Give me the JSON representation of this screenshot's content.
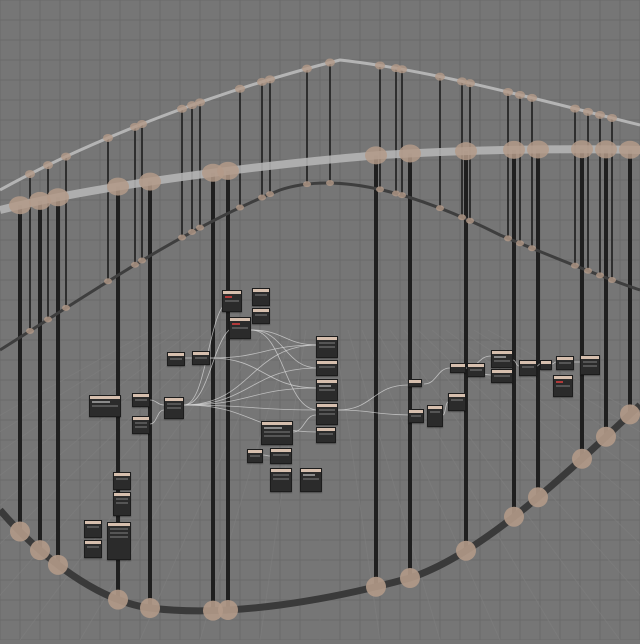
{
  "scene": {
    "background": "#767676",
    "grid_color": "#6a6a6a",
    "rail_color": "#3e3e3e",
    "guide_color": "#b4b4b4",
    "joint_color": "#b39a88",
    "node_body_color": "#2b2b2b",
    "node_header_color": "#d6bfae",
    "wire_color": "#d8d8d8"
  }
}
